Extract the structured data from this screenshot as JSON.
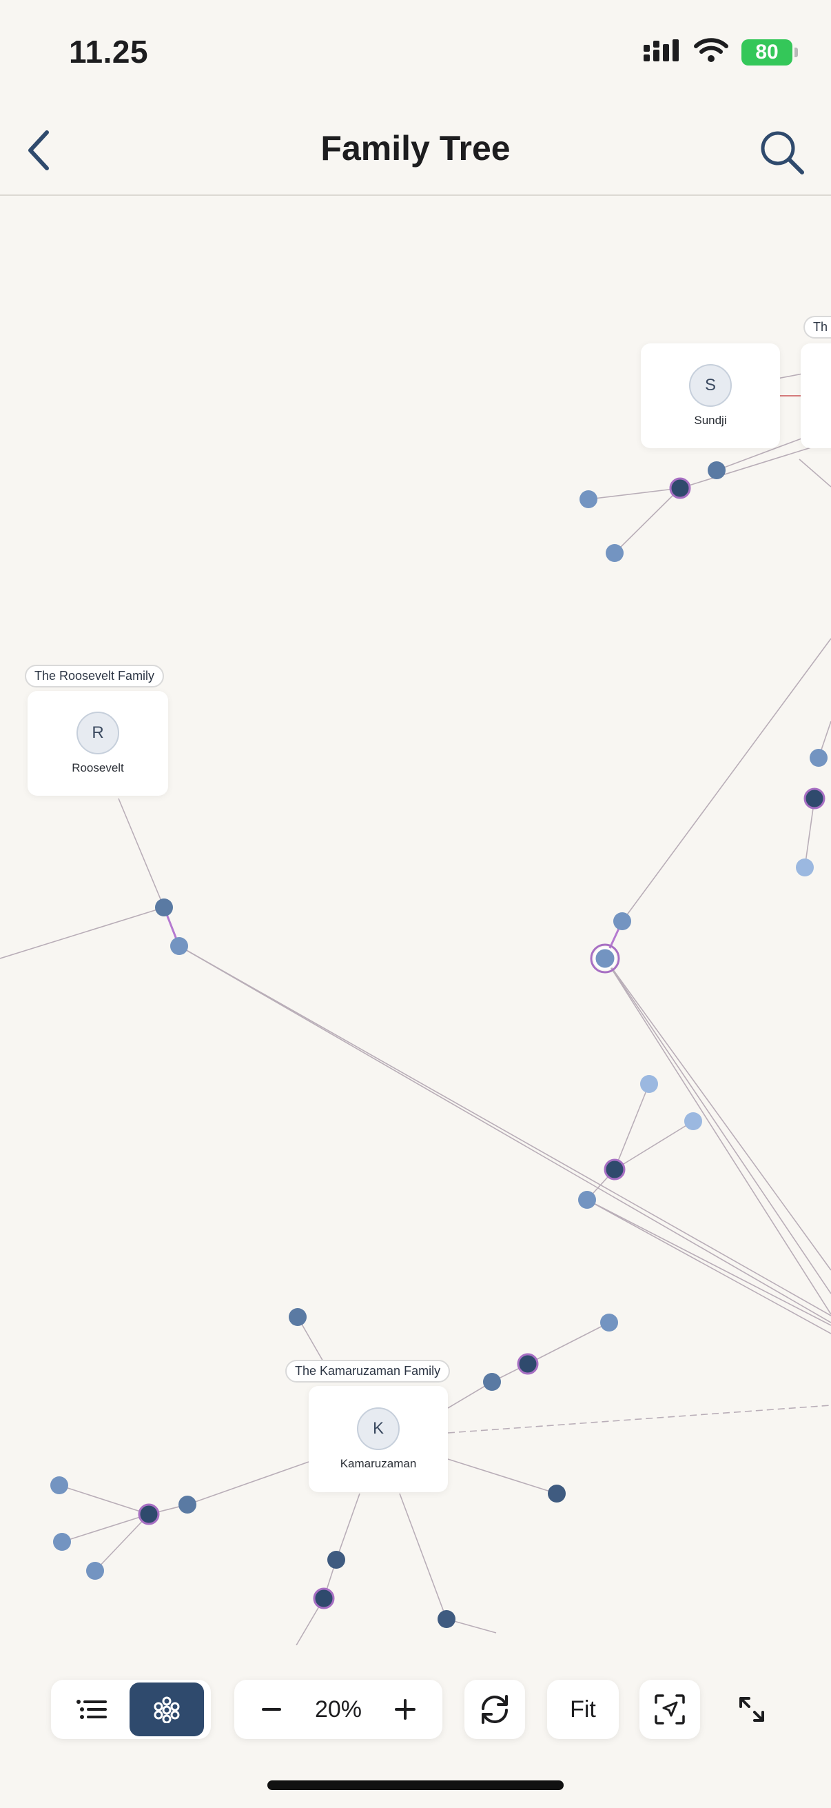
{
  "status_bar": {
    "time": "11.25",
    "battery": "80"
  },
  "header": {
    "title": "Family Tree"
  },
  "families": [
    {
      "label": "The Roosevelt Family",
      "member": "Roosevelt",
      "initial": "R"
    },
    {
      "label": "The Kamaruzaman Family",
      "member": "Kamaruzaman",
      "initial": "K"
    },
    {
      "label": "Th",
      "member": "Sundji",
      "initial": "S"
    }
  ],
  "toolbar": {
    "zoom_level": "20%",
    "fit_label": "Fit"
  },
  "colors": {
    "background": "#f8f6f2",
    "node_dark": "#2f4a6d",
    "node_mid": "#5a7aa3",
    "node_light": "#9bb8e0",
    "accent_ring": "#a76fc3",
    "active_toggle": "#2f4a6d",
    "battery": "#34c759"
  }
}
